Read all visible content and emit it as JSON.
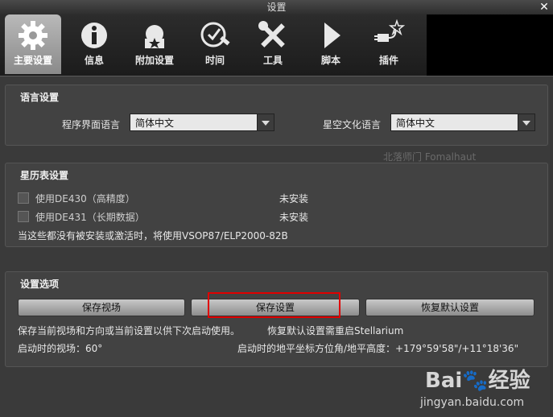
{
  "window": {
    "title": "设置"
  },
  "tabs": [
    {
      "label": "主要设置",
      "icon": "gear-icon",
      "active": true
    },
    {
      "label": "信息",
      "icon": "info-icon"
    },
    {
      "label": "附加设置",
      "icon": "extras-icon"
    },
    {
      "label": "时间",
      "icon": "clock-icon"
    },
    {
      "label": "工具",
      "icon": "tools-icon"
    },
    {
      "label": "脚本",
      "icon": "play-icon"
    },
    {
      "label": "插件",
      "icon": "plugin-icon"
    }
  ],
  "language": {
    "title": "语言设置",
    "ui_label": "程序界面语言",
    "ui_value": "简体中文",
    "sky_label": "星空文化语言",
    "sky_value": "简体中文",
    "star_overlay": "北落师门 Fomalhaut"
  },
  "ephemeris": {
    "title": "星历表设置",
    "items": [
      {
        "label": "使用DE430（高精度）",
        "status": "未安装"
      },
      {
        "label": "使用DE431（长期数据）",
        "status": "未安装"
      }
    ],
    "note": "当这些都没有被安装或激活时，将使用VSOP87/ELP2000-82B"
  },
  "options": {
    "title": "设置选项",
    "save_view": "保存视场",
    "save_settings": "保存设置",
    "restore_defaults": "恢复默认设置",
    "desc_left": "保存当前视场和方向或当前设置以供下次启动使用。",
    "desc_right": "恢复默认设置需重启Stellarium",
    "startup_fov": "启动时的视场：60°",
    "startup_coords": "启动时的地平坐标方位角/地平高度：+179°59'58\"/+11°18'36\""
  },
  "watermark": {
    "logo": "Bai🐾经验",
    "url": "jingyan.baidu.com"
  }
}
